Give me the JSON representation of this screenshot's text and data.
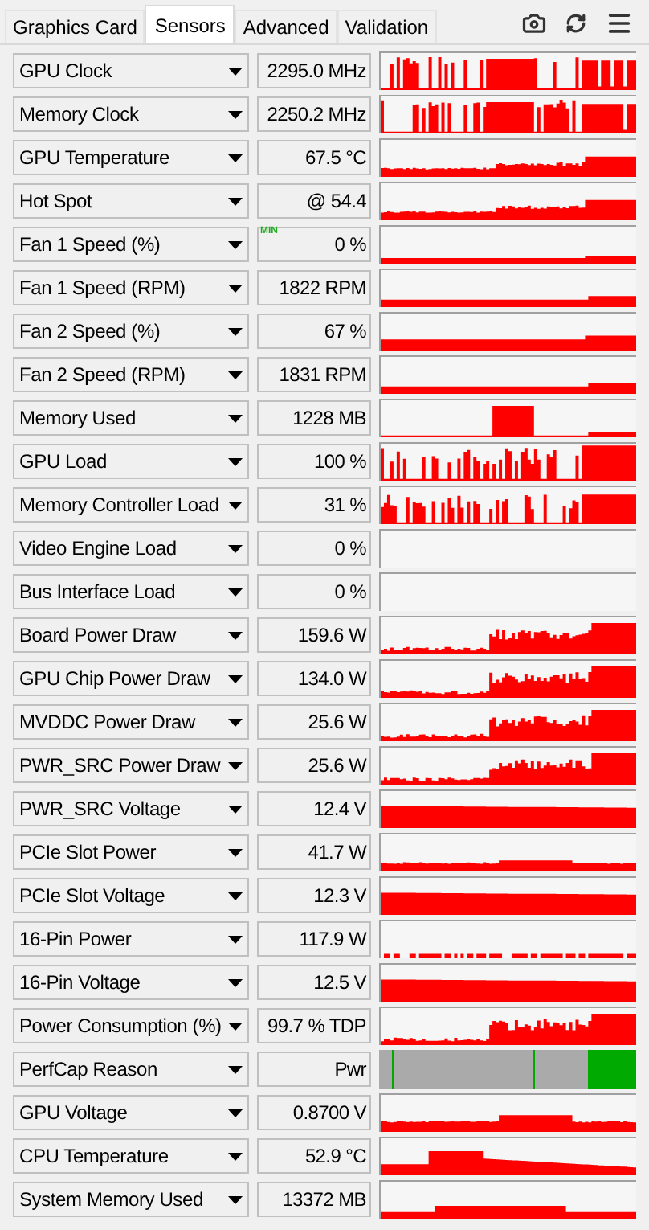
{
  "tabs": [
    {
      "label": "Graphics Card",
      "selected": false
    },
    {
      "label": "Sensors",
      "selected": true
    },
    {
      "label": "Advanced",
      "selected": false
    },
    {
      "label": "Validation",
      "selected": false
    }
  ],
  "sensors": [
    {
      "name": "GPU Clock",
      "value": "2295.0 MHz",
      "kind": "graph"
    },
    {
      "name": "Memory Clock",
      "value": "2250.2 MHz",
      "kind": "graph"
    },
    {
      "name": "GPU Temperature",
      "value": "67.5 °C",
      "kind": "graph"
    },
    {
      "name": "Hot Spot",
      "value": "@ 54.4",
      "kind": "graph"
    },
    {
      "name": "Fan 1 Speed (%)",
      "value": "0 %",
      "badge": "MIN",
      "kind": "graph"
    },
    {
      "name": "Fan 1 Speed (RPM)",
      "value": "1822 RPM",
      "kind": "graph"
    },
    {
      "name": "Fan 2 Speed (%)",
      "value": "67 %",
      "kind": "graph"
    },
    {
      "name": "Fan 2 Speed (RPM)",
      "value": "1831 RPM",
      "kind": "graph"
    },
    {
      "name": "Memory Used",
      "value": "1228 MB",
      "kind": "graph"
    },
    {
      "name": "GPU Load",
      "value": "100 %",
      "kind": "graph"
    },
    {
      "name": "Memory Controller Load",
      "value": "31 %",
      "kind": "graph"
    },
    {
      "name": "Video Engine Load",
      "value": "0 %",
      "kind": "graph"
    },
    {
      "name": "Bus Interface Load",
      "value": "0 %",
      "kind": "graph"
    },
    {
      "name": "Board Power Draw",
      "value": "159.6 W",
      "kind": "graph"
    },
    {
      "name": "GPU Chip Power Draw",
      "value": "134.0 W",
      "kind": "graph"
    },
    {
      "name": "MVDDC Power Draw",
      "value": "25.6 W",
      "kind": "graph"
    },
    {
      "name": "PWR_SRC Power Draw",
      "value": "25.6 W",
      "kind": "graph"
    },
    {
      "name": "PWR_SRC Voltage",
      "value": "12.4 V",
      "kind": "graph"
    },
    {
      "name": "PCIe Slot Power",
      "value": "41.7 W",
      "kind": "graph"
    },
    {
      "name": "PCIe Slot Voltage",
      "value": "12.3 V",
      "kind": "graph"
    },
    {
      "name": "16-Pin Power",
      "value": "117.9 W",
      "kind": "graph"
    },
    {
      "name": "16-Pin Voltage",
      "value": "12.5 V",
      "kind": "graph"
    },
    {
      "name": "Power Consumption (%)",
      "value": "99.7 % TDP",
      "kind": "graph"
    },
    {
      "name": "PerfCap Reason",
      "value": "Pwr",
      "kind": "perfcap"
    },
    {
      "name": "GPU Voltage",
      "value": "0.8700 V",
      "kind": "graph"
    },
    {
      "name": "CPU Temperature",
      "value": "52.9 °C",
      "kind": "graph"
    },
    {
      "name": "System Memory Used",
      "value": "13372 MB",
      "kind": "graph"
    }
  ]
}
